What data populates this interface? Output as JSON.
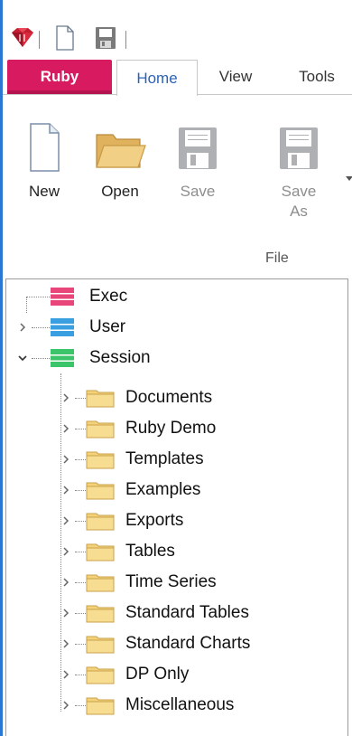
{
  "tabs": {
    "ruby": "Ruby",
    "home": "Home",
    "view": "View",
    "tools": "Tools"
  },
  "ribbon": {
    "new_label": "New",
    "open_label": "Open",
    "save_label": "Save",
    "save_as_line1": "Save",
    "save_as_line2": "As",
    "group_file": "File"
  },
  "tree": {
    "exec": "Exec",
    "user": "User",
    "session": "Session",
    "folders": [
      "Documents",
      "Ruby Demo",
      "Templates",
      "Examples",
      "Exports",
      "Tables",
      "Time Series",
      "Standard Tables",
      "Standard Charts",
      "DP Only",
      "Miscellaneous"
    ]
  },
  "colors": {
    "accent_blue": "#2b78d4",
    "ruby_tab": "#d81b60",
    "exec_db": "#e8457a",
    "user_db": "#3a9fe0",
    "session_db": "#3cc46a",
    "folder": "#f3d27a"
  },
  "icons": {
    "app": "ruby-logo-icon",
    "qat_new": "new-document-icon",
    "qat_save": "save-disk-icon"
  }
}
